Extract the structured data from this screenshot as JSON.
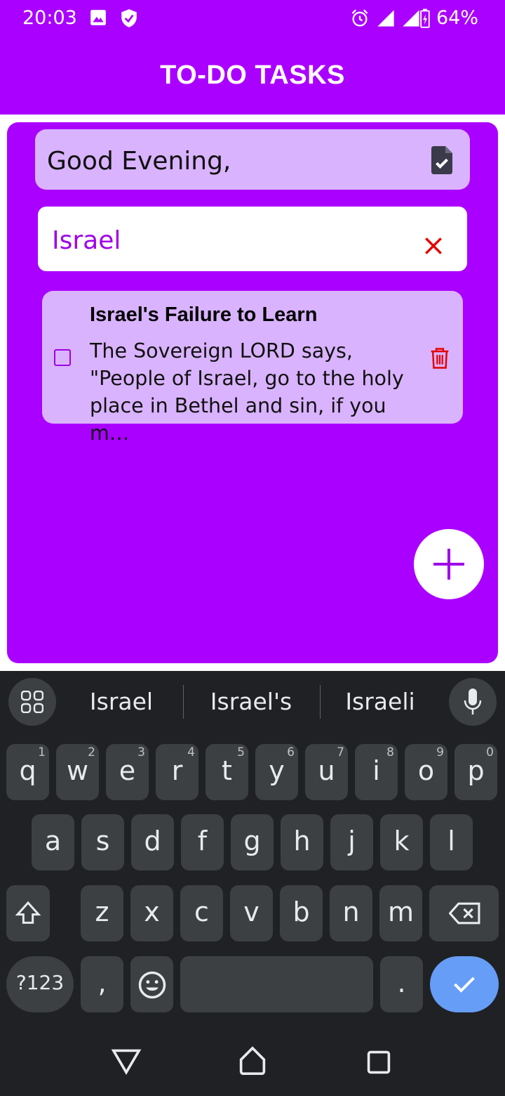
{
  "status_bar": {
    "time": "20:03",
    "battery": "64%",
    "icons": [
      "image-icon",
      "shield-icon",
      "alarm-icon",
      "signal-icon",
      "signal-icon",
      "battery-charging-icon"
    ]
  },
  "app_bar": {
    "title": "TO-DO TASKS"
  },
  "greeting": {
    "text": "Good Evening,",
    "icon": "document-check-icon"
  },
  "search": {
    "value": "Israel",
    "clear_icon": "close-icon"
  },
  "tasks": [
    {
      "title": "Israel's Failure to Learn",
      "body": "The Sovereign LORD says, \"People of Israel, go to the holy place in Bethel and sin, if you m…",
      "checked": false
    }
  ],
  "fab": {
    "icon": "plus-icon"
  },
  "keyboard": {
    "suggestions": [
      "Israel",
      "Israel's",
      "Israeli"
    ],
    "row1": [
      {
        "k": "q",
        "h": "1"
      },
      {
        "k": "w",
        "h": "2"
      },
      {
        "k": "e",
        "h": "3"
      },
      {
        "k": "r",
        "h": "4"
      },
      {
        "k": "t",
        "h": "5"
      },
      {
        "k": "y",
        "h": "6"
      },
      {
        "k": "u",
        "h": "7"
      },
      {
        "k": "i",
        "h": "8"
      },
      {
        "k": "o",
        "h": "9"
      },
      {
        "k": "p",
        "h": "0"
      }
    ],
    "row2": [
      "a",
      "s",
      "d",
      "f",
      "g",
      "h",
      "j",
      "k",
      "l"
    ],
    "row3": [
      "z",
      "x",
      "c",
      "v",
      "b",
      "n",
      "m"
    ],
    "symbols_label": "?123",
    "comma": ",",
    "period": "."
  },
  "colors": {
    "primary": "#aa00ff",
    "card": "#dab3ff",
    "accent_text": "#a000e8",
    "danger": "#e60000",
    "keyboard_bg": "#202124",
    "key_bg": "#3c4043",
    "enter_key": "#669df6"
  }
}
